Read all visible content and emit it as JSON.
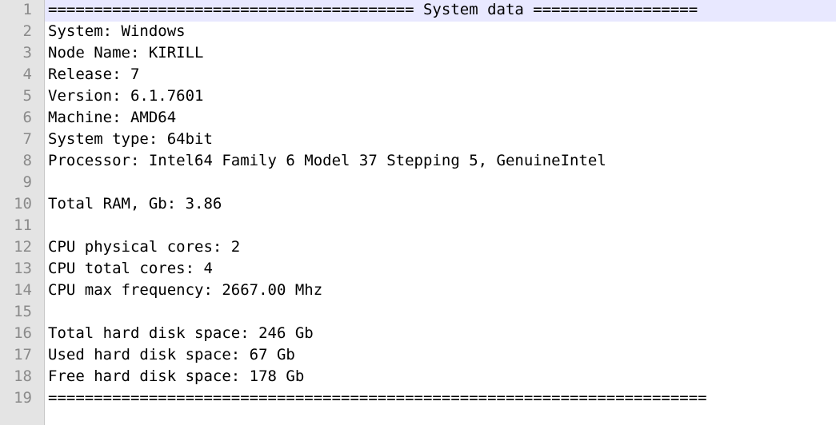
{
  "editor": {
    "lines": [
      {
        "number": "1",
        "text": "======================================== System data =================="
      },
      {
        "number": "2",
        "text": "System: Windows"
      },
      {
        "number": "3",
        "text": "Node Name: KIRILL"
      },
      {
        "number": "4",
        "text": "Release: 7"
      },
      {
        "number": "5",
        "text": "Version: 6.1.7601"
      },
      {
        "number": "6",
        "text": "Machine: AMD64"
      },
      {
        "number": "7",
        "text": "System type: 64bit"
      },
      {
        "number": "8",
        "text": "Processor: Intel64 Family 6 Model 37 Stepping 5, GenuineIntel"
      },
      {
        "number": "9",
        "text": ""
      },
      {
        "number": "10",
        "text": "Total RAM, Gb: 3.86"
      },
      {
        "number": "11",
        "text": ""
      },
      {
        "number": "12",
        "text": "CPU physical cores: 2"
      },
      {
        "number": "13",
        "text": "CPU total cores: 4"
      },
      {
        "number": "14",
        "text": "CPU max frequency: 2667.00 Mhz"
      },
      {
        "number": "15",
        "text": ""
      },
      {
        "number": "16",
        "text": "Total hard disk space: 246 Gb"
      },
      {
        "number": "17",
        "text": "Used hard disk space: 67 Gb"
      },
      {
        "number": "18",
        "text": "Free hard disk space: 178 Gb"
      },
      {
        "number": "19",
        "text": "========================================================================"
      }
    ]
  }
}
